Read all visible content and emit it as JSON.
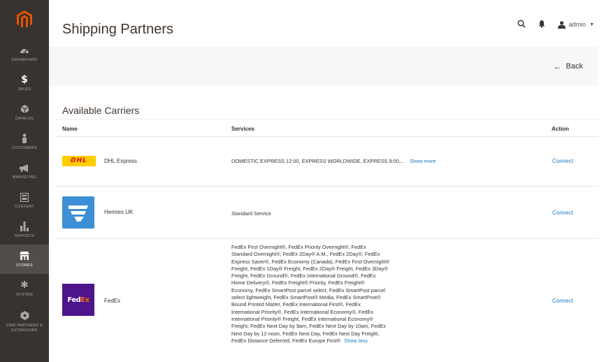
{
  "sidebar": {
    "items": [
      {
        "label": "DASHBOARD",
        "icon": "dashboard-icon"
      },
      {
        "label": "SALES",
        "icon": "dollar-icon"
      },
      {
        "label": "CATALOG",
        "icon": "cube-icon"
      },
      {
        "label": "CUSTOMERS",
        "icon": "person-icon"
      },
      {
        "label": "MARKETING",
        "icon": "megaphone-icon"
      },
      {
        "label": "CONTENT",
        "icon": "content-icon"
      },
      {
        "label": "REPORTS",
        "icon": "bar-chart-icon"
      },
      {
        "label": "STORES",
        "icon": "store-icon"
      },
      {
        "label": "SYSTEM",
        "icon": "gear-icon"
      },
      {
        "label": "FIND PARTNERS & EXTENSIONS",
        "icon": "partners-icon"
      }
    ]
  },
  "header": {
    "title": "Shipping Partners",
    "user": "admin"
  },
  "actions": {
    "back_label": "Back"
  },
  "section": {
    "title": "Available Carriers"
  },
  "grid": {
    "columns": {
      "name": "Name",
      "services": "Services",
      "action": "Action"
    },
    "rows": [
      {
        "name": "DHL Express",
        "services": "DOMESTIC EXPRESS 12:00, EXPRESS WORLDWIDE, EXPRESS 9:00,...",
        "toggle": "Show more",
        "action": "Connect"
      },
      {
        "name": "Hermes UK",
        "services": "Standard Service",
        "action": "Connect"
      },
      {
        "name": "FedEx",
        "services_lines": [
          "FedEx First Overnight®, FedEx Priority Overnight®, FedEx",
          "Standard Overnight®, FedEx 2Day® A.M., FedEx 2Day®, FedEx",
          "Express Saver®, FedEx Economy (Canada), FedEx First Overnight®",
          "Freight, FedEx 1Day® Freight, FedEx 2Day® Freight, FedEx 3Day®",
          "Freight, FedEx Ground®, FedEx International Ground®, FedEx",
          "Home Delivery®, FedEx Freight® Priority, FedEx Freight®",
          "Economy, FedEx SmartPost parcel select, FedEx SmartPost parcel",
          "select lightweight, FedEx SmartPost® Media, FedEx SmartPost®",
          "Bound Printed Matter, FedEx International First®, FedEx",
          "International Priority®, FedEx International Economy®, FedEx",
          "International Priority® Freight, FedEx International Economy®",
          "Freight, FedEx Next Day by 9am, FedEx Next Day by 10am, FedEx",
          "Next Day by 12 noon, FedEx Next Day, FedEx Next Day Freight,",
          "FedEx Distance Deferred, FedEx Europe First®"
        ],
        "toggle": "Show less",
        "action": "Connect"
      }
    ]
  },
  "logos": {
    "dhl": "DHL",
    "fedex_fed": "Fed",
    "fedex_ex": "Ex"
  },
  "colors": {
    "sidebar": "#373330",
    "magento_orange": "#eb5202",
    "link": "#1979c3",
    "dhl_yellow": "#ffcc00",
    "dhl_red": "#d40511",
    "hermes_blue": "#3d8fd6",
    "fedex_purple": "#4d148c",
    "fedex_orange": "#ff6600"
  }
}
